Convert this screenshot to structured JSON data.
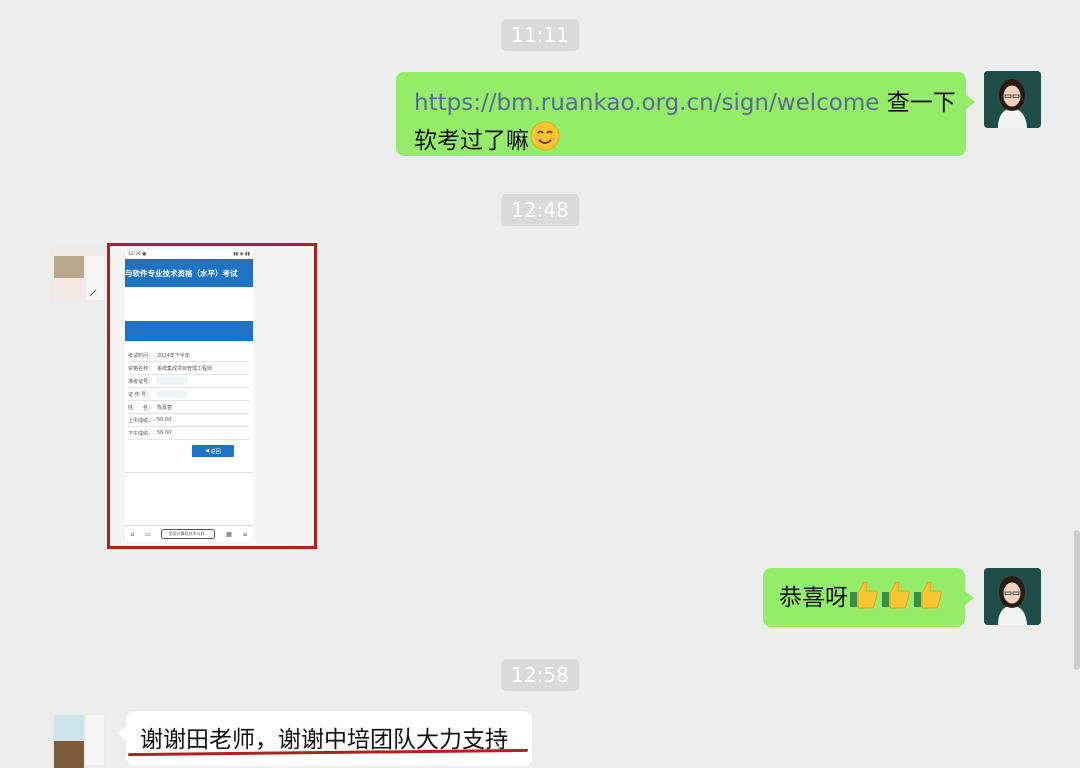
{
  "chat": {
    "messages": [
      {
        "type": "timestamp",
        "text": "11:11"
      },
      {
        "type": "outgoing_text",
        "link": "https://bm.ruankao.org.cn/sign/welcome",
        "text_after_link": " 查一下",
        "line2": "软考过了嘛",
        "emoji": "smiling-face-icon"
      },
      {
        "type": "timestamp",
        "text": "12:48"
      },
      {
        "type": "incoming_image",
        "description_icon": "phone-screenshot"
      },
      {
        "type": "outgoing_text",
        "text": "恭喜呀",
        "emoji": "thumbs-up-icon"
      },
      {
        "type": "timestamp",
        "text": "12:58"
      },
      {
        "type": "incoming_text",
        "text": "谢谢田老师，谢谢中培团队大力支持"
      }
    ]
  },
  "screenshot": {
    "banner": "与软件专业技术资格（水平）考试",
    "rows": [
      {
        "label": "考试时间：",
        "value": "2024年下半年"
      },
      {
        "label": "资格名称：",
        "value": "系统集成项目管理工程师"
      },
      {
        "label": "准考证号：",
        "value": ""
      },
      {
        "label": "证 件 号：",
        "value": ""
      },
      {
        "label": "姓　　名：",
        "value": "陈嘉萱"
      },
      {
        "label": "上午成绩：",
        "value": "50.00"
      },
      {
        "label": "下午成绩：",
        "value": "56.00"
      }
    ],
    "back_button": "返回",
    "address_bar": "全国计算机技术与软..."
  },
  "colors": {
    "outgoing_bubble": "#95ec69",
    "incoming_bubble": "#ffffff",
    "link": "#576b95",
    "highlight": "#b41e1e",
    "banner": "#1f72c4"
  }
}
